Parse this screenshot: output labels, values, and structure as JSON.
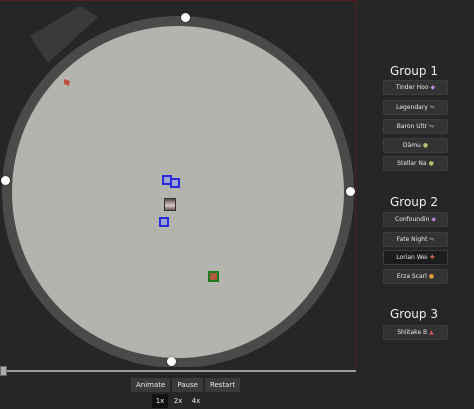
{
  "controls": {
    "animate": "Animate",
    "pause": "Pause",
    "restart": "Restart"
  },
  "speeds": [
    "1x",
    "2x",
    "4x"
  ],
  "active_speed": "1x",
  "timeline_progress": 0,
  "groups": [
    {
      "title": "Group 1",
      "players": [
        {
          "name": "Tinder Hoo",
          "icon": "purple-gem-icon",
          "color": "#b48ae0"
        },
        {
          "name": "Legendary",
          "icon": "arrows-icon",
          "color": "#999999"
        },
        {
          "name": "Baron Ultr",
          "icon": "arrows-icon",
          "color": "#999999"
        },
        {
          "name": "Dāmu",
          "icon": "leaf-icon",
          "color": "#b0c070"
        },
        {
          "name": "Stellar Na",
          "icon": "leaf-icon",
          "color": "#b0c070"
        }
      ]
    },
    {
      "title": "Group 2",
      "players": [
        {
          "name": "Confoundin",
          "icon": "purple-gem-icon",
          "color": "#b48ae0"
        },
        {
          "name": "Fate Night",
          "icon": "arrows-icon",
          "color": "#999999"
        },
        {
          "name": "Lorian Wei",
          "icon": "cross-icon",
          "color": "#d46a5a",
          "active": true
        },
        {
          "name": "Erza Scarl",
          "icon": "shield-icon",
          "color": "#e0a040"
        }
      ]
    },
    {
      "title": "Group 3",
      "players": [
        {
          "name": "Shiitake B",
          "icon": "boot-icon",
          "color": "#d05050"
        }
      ]
    }
  ]
}
